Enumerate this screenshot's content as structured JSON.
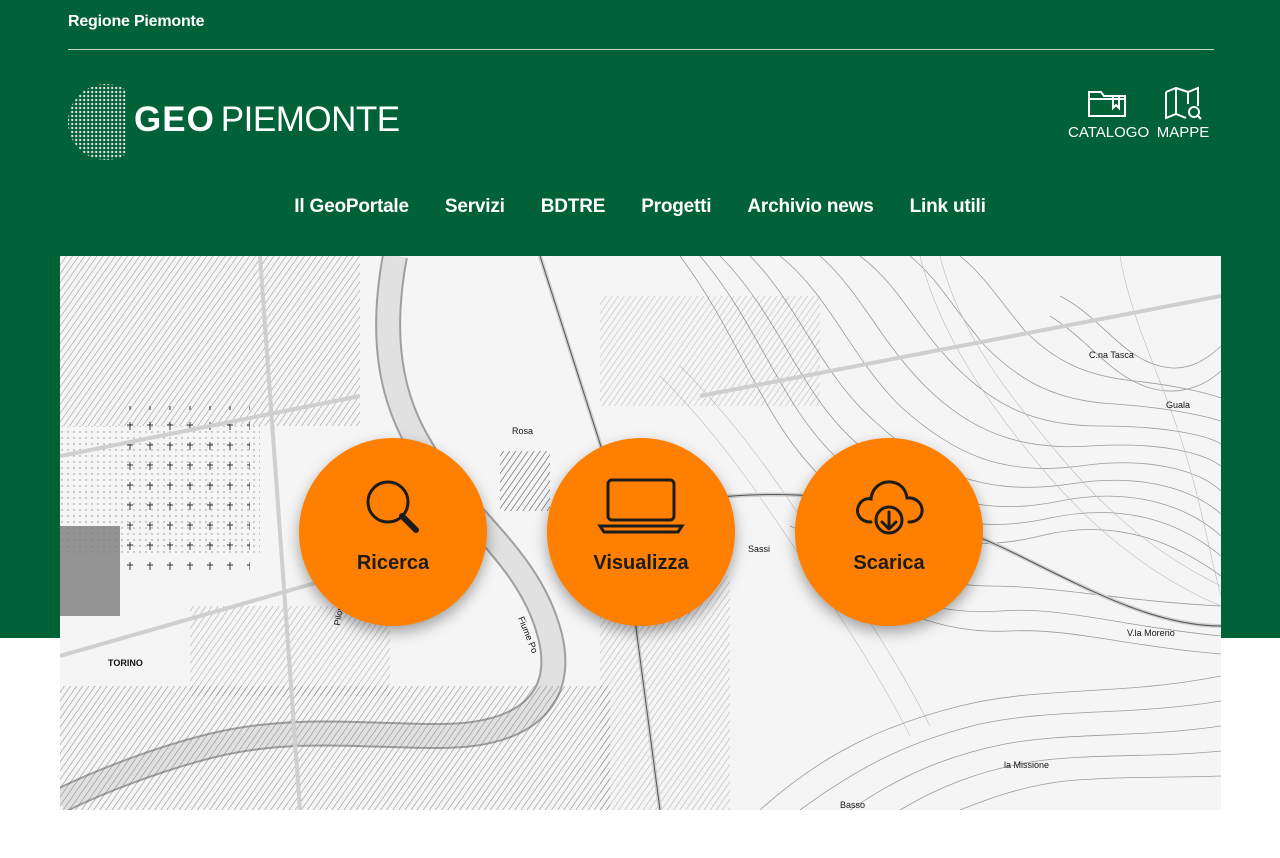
{
  "topbar": {
    "region": "Regione Piemonte"
  },
  "logo": {
    "geo": "GEO",
    "piemonte": "PIEMONTE"
  },
  "tools": {
    "catalogo": "CATALOGO",
    "mappe": "MAPPE"
  },
  "nav": [
    {
      "label": "Il GeoPortale"
    },
    {
      "label": "Servizi"
    },
    {
      "label": "BDTRE"
    },
    {
      "label": "Progetti"
    },
    {
      "label": "Archivio news"
    },
    {
      "label": "Link utili"
    }
  ],
  "actions": [
    {
      "label": "Ricerca",
      "icon": "search-icon"
    },
    {
      "label": "Visualizza",
      "icon": "laptop-icon"
    },
    {
      "label": "Scarica",
      "icon": "cloud-download-icon"
    }
  ],
  "map_labels": {
    "torino": "TORINO",
    "rosa": "Rosa",
    "sassi": "Sassi",
    "cna_tasca": "C.na Tasca",
    "guala": "Guala",
    "villa_moreno": "V.la Moreno",
    "la_missione": "la Missione",
    "fiume_po": "Fiume Po",
    "pilonetto": "Pilonetto",
    "basso": "Basso"
  },
  "colors": {
    "brand_green": "#006236",
    "accent_orange": "#ff7f00"
  }
}
